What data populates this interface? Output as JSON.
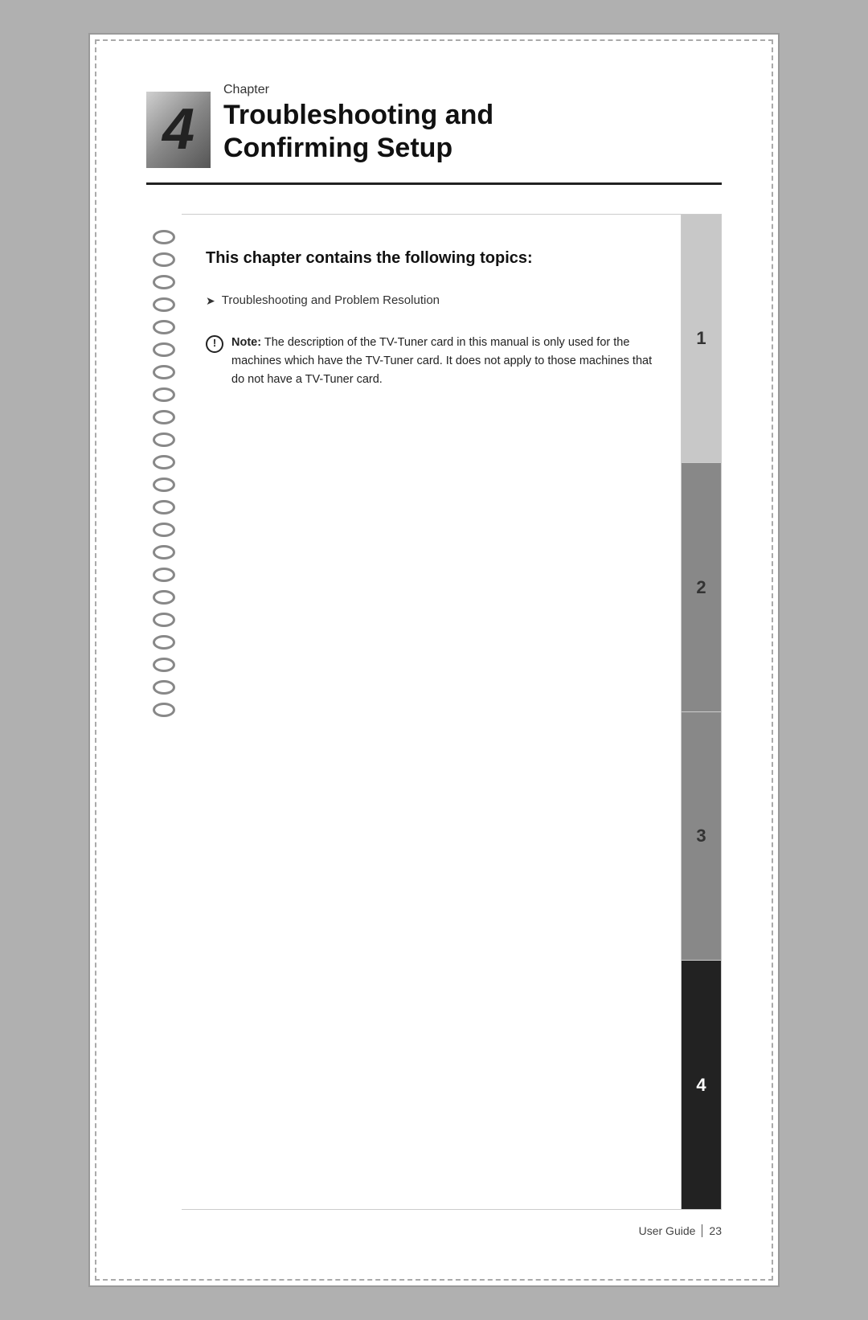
{
  "page": {
    "chapter_number": "4",
    "chapter_label": "Chapter",
    "chapter_title_line1": "Troubleshooting and",
    "chapter_title_line2": "Confirming Setup",
    "notebook": {
      "heading": "This chapter contains the following topics:",
      "topics": [
        "Troubleshooting and Problem Resolution"
      ],
      "note": {
        "label": "Note:",
        "text": "The description of the TV-Tuner card in this manual is only used for the machines which have the TV-Tuner card. It does not apply to those machines that do not have a TV-Tuner card."
      }
    },
    "tabs": [
      {
        "number": "1",
        "state": "inactive-light"
      },
      {
        "number": "2",
        "state": "inactive-dark"
      },
      {
        "number": "3",
        "state": "inactive-dark"
      },
      {
        "number": "4",
        "state": "active"
      }
    ],
    "footer": {
      "guide_label": "User Guide",
      "page_number": "23"
    },
    "spiral_count": 22
  }
}
